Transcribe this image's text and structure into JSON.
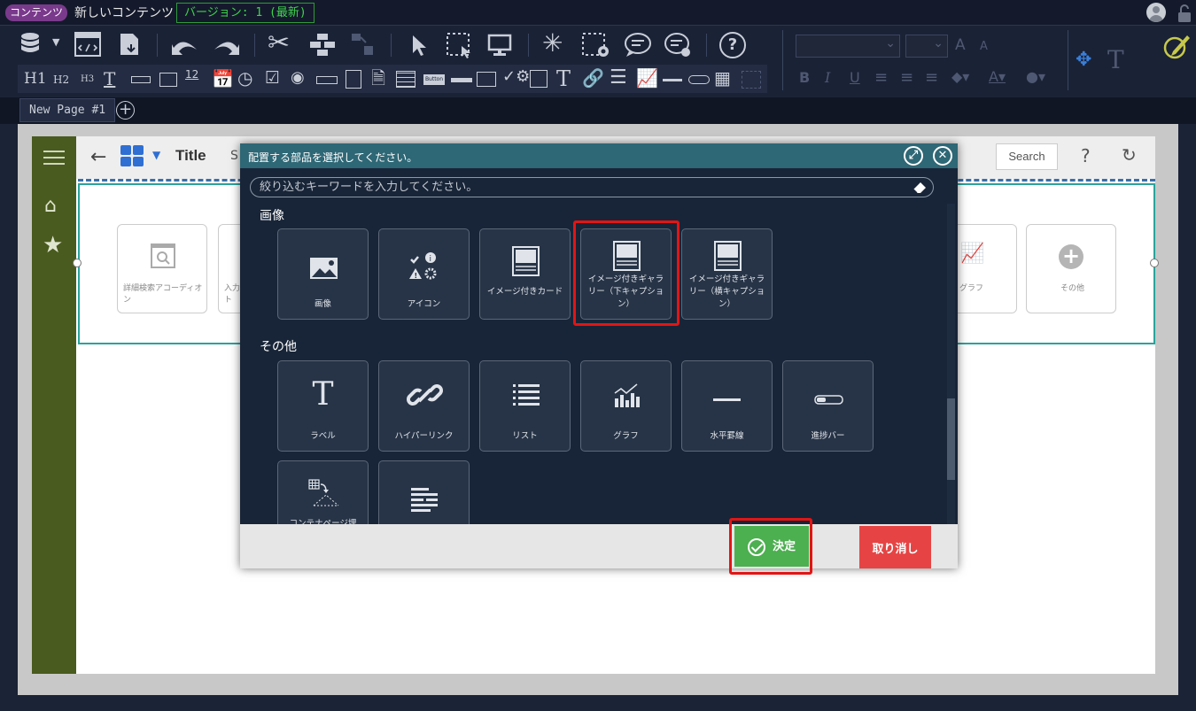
{
  "titlebar": {
    "tag": "コンテンツ",
    "content_title": "新しいコンテンツ",
    "version": "バージョン: 1 (最新)"
  },
  "toolbar": {
    "row2_text_icons": [
      "H1",
      "H2",
      "H3"
    ],
    "row2_number_icon": "12",
    "row2_button_icon": "Button",
    "row2_text_tool": "T"
  },
  "page_tabs": {
    "tabs": [
      {
        "label": "New Page #1"
      }
    ],
    "add_label": "+"
  },
  "preview": {
    "title": "Title",
    "title_suffix": "S",
    "search_button": "Search",
    "cards": [
      {
        "label": "詳細検索アコーディオン"
      },
      {
        "label": "入力ト"
      },
      {
        "label": "グラフ"
      },
      {
        "label": "その他"
      }
    ]
  },
  "modal": {
    "title": "配置する部品を選択してください。",
    "filter_placeholder": "絞り込むキーワードを入力してください。",
    "sections": [
      {
        "name": "画像",
        "items": [
          {
            "label": "画像",
            "icon": "image-icon"
          },
          {
            "label": "アイコン",
            "icon": "icon-set-icon"
          },
          {
            "label": "イメージ付きカード",
            "icon": "image-card-icon"
          },
          {
            "label": "イメージ付きギャラリー（下キャプション）",
            "icon": "gallery-bottom-caption-icon",
            "highlighted": true
          },
          {
            "label": "イメージ付きギャラリー（横キャプション）",
            "icon": "gallery-side-caption-icon"
          }
        ]
      },
      {
        "name": "その他",
        "items": [
          {
            "label": "ラベル",
            "icon": "label-icon"
          },
          {
            "label": "ハイパーリンク",
            "icon": "link-icon"
          },
          {
            "label": "リスト",
            "icon": "list-icon"
          },
          {
            "label": "グラフ",
            "icon": "chart-icon"
          },
          {
            "label": "水平罫線",
            "icon": "hr-icon"
          },
          {
            "label": "進捗バー",
            "icon": "progress-icon"
          },
          {
            "label": "コンテナページ埋",
            "icon": "container-page-icon"
          },
          {
            "label": "",
            "icon": "text-lines-icon"
          }
        ]
      }
    ],
    "ok_label": "決定",
    "cancel_label": "取り消し"
  },
  "colors": {
    "modal_header": "#2e6775",
    "highlight": "#e21515",
    "ok": "#4caf50",
    "cancel": "#e64444",
    "version_green": "#3fd44e"
  }
}
